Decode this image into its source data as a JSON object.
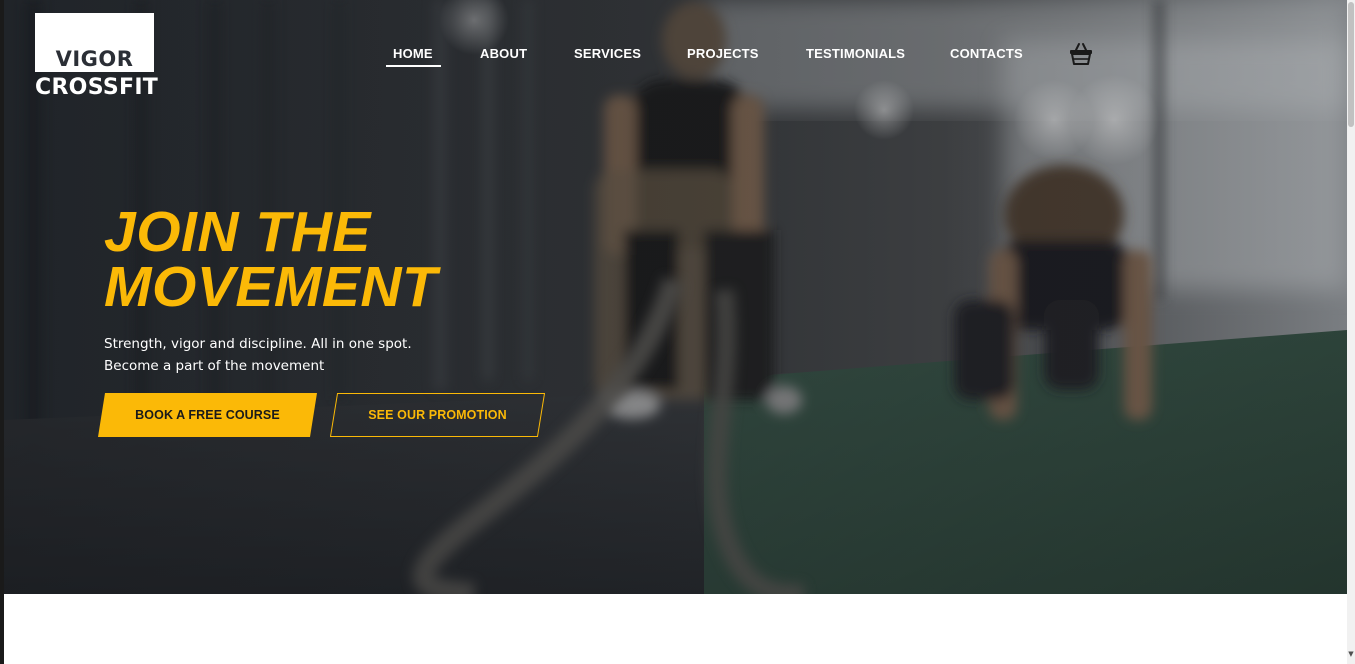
{
  "brand": {
    "line1": "VIGOR",
    "line2": "CROSSFIT"
  },
  "nav": {
    "items": [
      {
        "label": "HOME",
        "active": true
      },
      {
        "label": "ABOUT"
      },
      {
        "label": "SERVICES"
      },
      {
        "label": "PROJECTS"
      },
      {
        "label": "TESTIMONIALS"
      },
      {
        "label": "CONTACTS"
      }
    ],
    "cart_icon": "basket-icon"
  },
  "hero": {
    "headline": [
      "JOIN THE",
      "MOVEMENT"
    ],
    "subtext": [
      "Strength, vigor and discipline. All in one spot.",
      "Become a part of the movement"
    ],
    "primary_button": "BOOK A FREE COURSE",
    "secondary_button": "SEE OUR PROMOTION"
  },
  "colors": {
    "accent": "#fbb907",
    "text_light": "#ffffff",
    "logo_dark": "#2b2f36"
  }
}
